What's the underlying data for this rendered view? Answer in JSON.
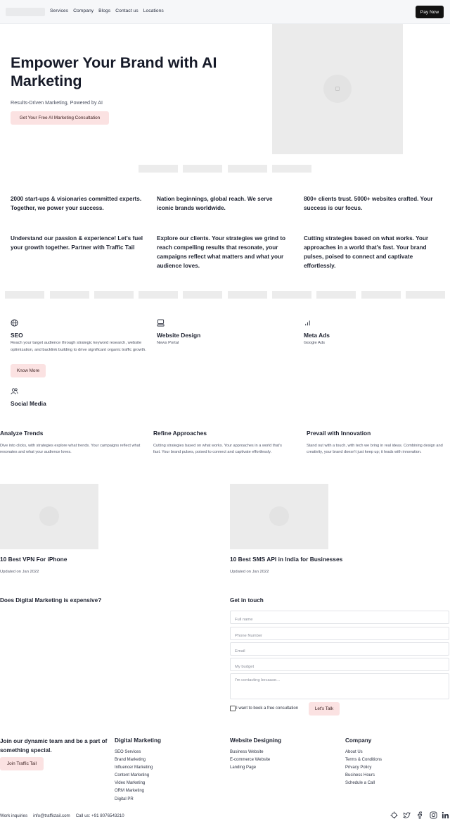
{
  "header": {
    "nav": [
      "Services",
      "Company",
      "Blogs",
      "Contact us",
      "Locations"
    ],
    "pay_now": "Pay Now"
  },
  "hero": {
    "title": "Empower Your Brand with AI Marketing",
    "subtitle": "Results-Driven Marketing, Powered by AI",
    "cta": "Get Your Free AI Marketing Consultation"
  },
  "stats": [
    "2000 start-ups & visionaries committed experts. Together, we power your success.",
    "Nation beginnings, global reach. We serve iconic brands worldwide.",
    "800+ clients trust. 5000+ websites crafted. Your success is our focus.",
    "Understand our passion & experience! Let's fuel your growth together. Partner with Traffic Tail",
    "Explore our clients. Your strategies we grind to reach compelling results that resonate, your campaigns reflect what matters and what your audience loves.",
    "Cutting strategies based on what works. Your approaches in a world that's fast. Your brand pulses, poised to connect and captivate effortlessly."
  ],
  "services": {
    "seo": {
      "icon": "globe-icon",
      "title": "SEO",
      "desc": "Reach your target audience through strategic keyword research, website optimization, and backlink building to drive significant organic traffic growth.",
      "button": "Know More"
    },
    "web": {
      "icon": "monitor-icon",
      "title": "Website Design",
      "sub": "News Portal"
    },
    "meta": {
      "icon": "bar-chart-icon",
      "title": "Meta Ads",
      "sub": "Google Ads"
    },
    "social": {
      "icon": "users-icon",
      "title": "Social Media"
    }
  },
  "trends": [
    {
      "title": "Analyze Trends",
      "desc": "Dive into clicks, with strategies explore what trends. Your campaigns reflect what resonates and what your audience loves."
    },
    {
      "title": "Refine Approaches",
      "desc": "Cutting strategies based on what works. Your approaches in a world that's fast. Your brand pulses, poised to connect and captivate effortlessly."
    },
    {
      "title": "Prevail with Innovation",
      "desc": "Stand out with a touch, with tech we bring in real ideas. Combining design and creativity, your brand doesn't just keep up; it leads with innovation."
    }
  ],
  "blogs": [
    {
      "title": "10 Best VPN For iPhone",
      "date": "Updated on Jan 2022"
    },
    {
      "title": "10 Best SMS API in India for Businesses",
      "date": "Updated on Jan 2022"
    }
  ],
  "faq": {
    "question": "Does Digital Marketing is expensive?"
  },
  "contact": {
    "title": "Get in touch",
    "placeholders": {
      "name": "Full name",
      "phone": "Phone Number",
      "email": "Email",
      "budget": "My budget",
      "message": "I'm contacting because..."
    },
    "checkbox_label": "I want to book a free consultation",
    "submit": "Let's Talk"
  },
  "footer": {
    "join_text": "Join our dynamic team and be a part of something special.",
    "join_button": "Join Traffic Tail",
    "columns": [
      {
        "title": "Digital Marketing",
        "items": [
          "SEO Services",
          "Brand Marketing",
          "Influencer Marketing",
          "Content Marketing",
          "Video Marketing",
          "ORM Marketing",
          "Digital PR"
        ]
      },
      {
        "title": "Website Designing",
        "items": [
          "Business Website",
          "E-commerce Website",
          "Landing Page"
        ]
      },
      {
        "title": "Company",
        "items": [
          "About Us",
          "Terms & Conditions",
          "Privacy Policy",
          "Business Hours",
          "Schedule a Call"
        ]
      }
    ],
    "work_inquiries": "Work inquiries",
    "email": "info@traffictail.com",
    "phone": "Call us: +91 8076543210",
    "social_icons": [
      "target-icon",
      "twitter-icon",
      "facebook-icon",
      "instagram-icon",
      "linkedin-icon"
    ]
  }
}
